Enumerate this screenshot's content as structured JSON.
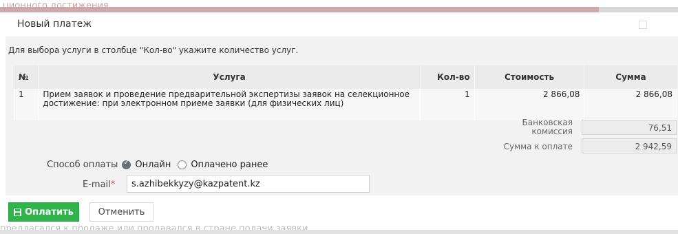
{
  "background": {
    "top_text": "ционного достижения",
    "bottom_text": "предлагался к продаже или продавался в стране подачи заявки"
  },
  "modal": {
    "title": "Новый платеж",
    "instruction": "Для выбора услуги в столбце \"Кол-во\" укажите количество услуг."
  },
  "table": {
    "headers": [
      "№",
      "Услуга",
      "Кол-во",
      "Стоимость",
      "Сумма"
    ],
    "rows": [
      {
        "num": "1",
        "service": "Прием заявок и проведение предварительной экспертизы заявок на селекционное достижение: при электронном приеме заявки (для физических лиц)",
        "qty": "1",
        "cost": "2 866,08",
        "sum": "2 866,08"
      }
    ]
  },
  "summary": {
    "commission_label": "Банковская комиссия",
    "commission_value": "76,51",
    "total_label": "Сумма к оплате",
    "total_value": "2 942,59"
  },
  "payment": {
    "method_label": "Способ оплаты",
    "options": [
      "Онлайн",
      "Оплачено ранее"
    ],
    "selected": "Онлайн",
    "email_label": "E-mail",
    "email_value": "s.azhibekkyzy@kazpatent.kz"
  },
  "actions": {
    "pay_label": "Оплатить",
    "cancel_label": "Отменить"
  },
  "colors": {
    "pay_button": "#2fb34a",
    "required_mark": "#d9534f"
  }
}
